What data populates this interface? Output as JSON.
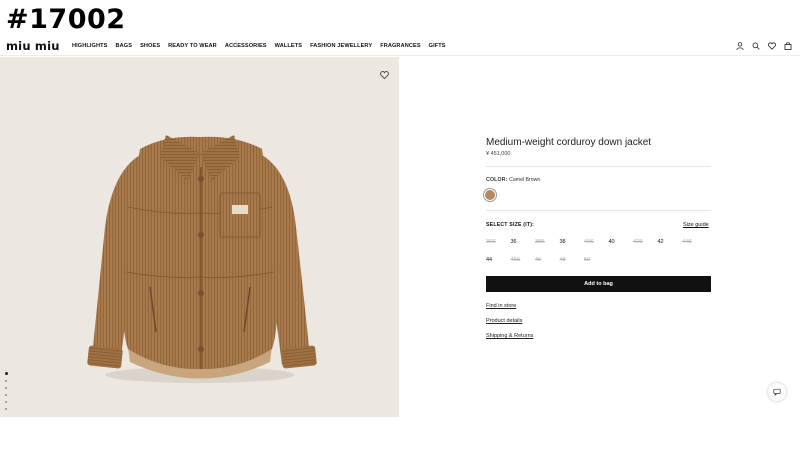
{
  "overlay_id": "#17002",
  "brand": {
    "logo": "miu miu"
  },
  "nav": [
    "HIGHLIGHTS",
    "BAGS",
    "SHOES",
    "READY TO WEAR",
    "ACCESSORIES",
    "WALLETS",
    "FASHION JEWELLERY",
    "FRAGRANCES",
    "GIFTS"
  ],
  "header_icons": [
    "account-icon",
    "search-icon",
    "wishlist-icon",
    "bag-icon"
  ],
  "product": {
    "title": "Medium-weight corduroy down jacket",
    "price": "¥ 451,000",
    "color_label": "COLOR:",
    "color_value": "Camel Brown",
    "swatch_color": "#b58a5d",
    "image_bg": "#ece8e1",
    "jacket_color": "#a8794b"
  },
  "size": {
    "label": "SELECT SIZE (IT):",
    "guide": "Size guide",
    "options": [
      {
        "label": "36S",
        "available": false
      },
      {
        "label": "36",
        "available": true
      },
      {
        "label": "38S",
        "available": false
      },
      {
        "label": "38",
        "available": true
      },
      {
        "label": "40S",
        "available": false
      },
      {
        "label": "40",
        "available": true
      },
      {
        "label": "42S",
        "available": false
      },
      {
        "label": "42",
        "available": true
      },
      {
        "label": "44S",
        "available": false
      },
      {
        "label": "44",
        "available": true
      },
      {
        "label": "46S",
        "available": false
      },
      {
        "label": "46",
        "available": false
      },
      {
        "label": "48",
        "available": false
      },
      {
        "label": "50",
        "available": false
      }
    ]
  },
  "actions": {
    "add_to_bag": "Add to bag",
    "find_in_store": "Find in store",
    "product_details": "Product details",
    "shipping_returns": "Shipping & Returns"
  },
  "gallery": {
    "images": 6,
    "current": 1
  }
}
